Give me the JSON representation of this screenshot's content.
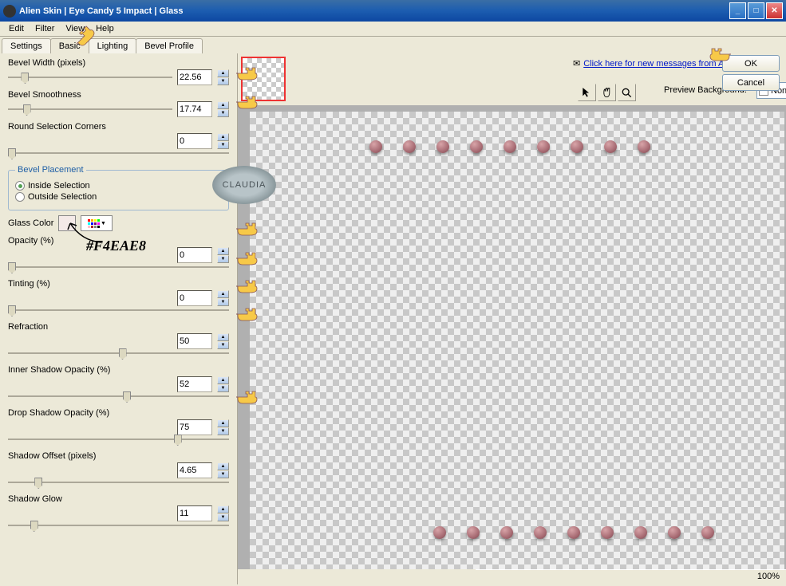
{
  "title": "Alien Skin  |  Eye Candy 5 Impact  |  Glass",
  "menu": [
    "Edit",
    "Filter",
    "View",
    "Help"
  ],
  "tabs": [
    "Settings",
    "Basic",
    "Lighting",
    "Bevel Profile"
  ],
  "active_tab": 1,
  "sliders": {
    "bevel_width": {
      "label": "Bevel Width (pixels)",
      "value": "22.56",
      "pos": 8
    },
    "bevel_smooth": {
      "label": "Bevel Smoothness",
      "value": "17.74",
      "pos": 9
    },
    "round_corners": {
      "label": "Round Selection Corners",
      "value": "0",
      "pos": 0
    },
    "opacity": {
      "label": "Opacity (%)",
      "value": "0",
      "pos": 0
    },
    "tinting": {
      "label": "Tinting (%)",
      "value": "0",
      "pos": 0
    },
    "refraction": {
      "label": "Refraction",
      "value": "50",
      "pos": 50
    },
    "inner_shadow": {
      "label": "Inner Shadow Opacity (%)",
      "value": "52",
      "pos": 52
    },
    "drop_shadow": {
      "label": "Drop Shadow Opacity (%)",
      "value": "75",
      "pos": 75
    },
    "shadow_offset": {
      "label": "Shadow Offset (pixels)",
      "value": "4.65",
      "pos": 12
    },
    "shadow_glow": {
      "label": "Shadow Glow",
      "value": "11",
      "pos": 10
    }
  },
  "bevel_placement": {
    "legend": "Bevel Placement",
    "inside": "Inside Selection",
    "outside": "Outside Selection"
  },
  "glass_color": {
    "label": "Glass Color",
    "hex": "#F4EAE8"
  },
  "toolbar": {
    "msg": "Click here for new messages from Alien Skin",
    "preview_bg_label": "Preview Background:",
    "preview_bg_value": "None",
    "ok": "OK",
    "cancel": "Cancel"
  },
  "status": {
    "zoom": "100%"
  },
  "annotation": {
    "hex_label": "#F4EAE8",
    "watermark": "CLAUDIA"
  }
}
